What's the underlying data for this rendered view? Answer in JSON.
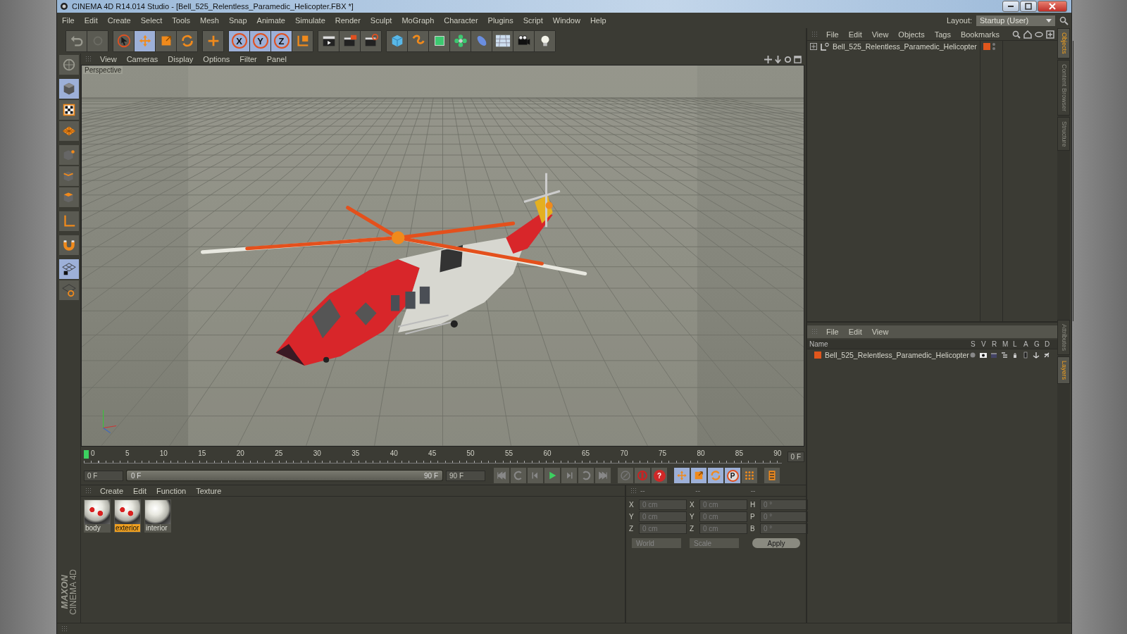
{
  "window": {
    "title": "CINEMA 4D R14.014 Studio - [Bell_525_Relentless_Paramedic_Helicopter.FBX *]"
  },
  "menu": [
    "File",
    "Edit",
    "Create",
    "Select",
    "Tools",
    "Mesh",
    "Snap",
    "Animate",
    "Simulate",
    "Render",
    "Sculpt",
    "MoGraph",
    "Character",
    "Plugins",
    "Script",
    "Window",
    "Help"
  ],
  "layout": {
    "label": "Layout:",
    "value": "Startup (User)"
  },
  "toolbar": [
    [
      {
        "kind": "undo",
        "selected": false
      },
      {
        "kind": "redo",
        "selected": false
      }
    ],
    [
      {
        "kind": "select",
        "selected": false
      },
      {
        "kind": "move",
        "selected": true
      },
      {
        "kind": "scale",
        "selected": false
      },
      {
        "kind": "rotate",
        "selected": false
      }
    ],
    [
      {
        "kind": "add",
        "selected": false
      }
    ],
    [
      {
        "kind": "axis",
        "label": "X",
        "selected": true
      },
      {
        "kind": "axis",
        "label": "Y",
        "selected": true
      },
      {
        "kind": "axis",
        "label": "Z",
        "selected": true
      },
      {
        "kind": "coord-system",
        "selected": false
      }
    ],
    [
      {
        "kind": "render-view",
        "selected": false
      },
      {
        "kind": "render-picture",
        "selected": false
      },
      {
        "kind": "render-settings",
        "selected": false
      }
    ],
    [
      {
        "kind": "cube",
        "selected": false
      },
      {
        "kind": "spline",
        "selected": false
      },
      {
        "kind": "nurbs",
        "selected": false
      },
      {
        "kind": "array",
        "selected": false
      },
      {
        "kind": "deformer",
        "selected": false
      },
      {
        "kind": "floor",
        "selected": false
      },
      {
        "kind": "camera",
        "selected": false
      },
      {
        "kind": "light",
        "selected": false
      }
    ]
  ],
  "side_tools": [
    [
      {
        "kind": "model",
        "selected": false
      }
    ],
    [
      {
        "kind": "object",
        "selected": true
      },
      {
        "kind": "texture",
        "selected": false
      },
      {
        "kind": "workplane",
        "selected": false
      }
    ],
    [
      {
        "kind": "points",
        "selected": false
      },
      {
        "kind": "edges",
        "selected": false
      },
      {
        "kind": "polygons",
        "selected": false
      }
    ],
    [
      {
        "kind": "axis-mode",
        "selected": false
      }
    ],
    [
      {
        "kind": "magnet",
        "selected": false
      }
    ],
    [
      {
        "kind": "snap",
        "selected": true
      },
      {
        "kind": "tweak",
        "selected": false
      }
    ]
  ],
  "viewport": {
    "menu": [
      "View",
      "Cameras",
      "Display",
      "Options",
      "Filter",
      "Panel"
    ],
    "camera": "Perspective"
  },
  "timeline": {
    "ticks": [
      "0",
      "5",
      "10",
      "15",
      "20",
      "25",
      "30",
      "35",
      "40",
      "45",
      "50",
      "55",
      "60",
      "65",
      "70",
      "75",
      "80",
      "85",
      "90"
    ],
    "current_frame": "0 F"
  },
  "transport": {
    "start": "0 F",
    "range_slider": {
      "start": "0 F",
      "end": "90 F",
      "level": 1
    },
    "end": "90 F",
    "buttons": [
      {
        "kind": "go-start",
        "selected": false
      },
      {
        "kind": "loop-back",
        "selected": false
      },
      {
        "kind": "prev-frame",
        "selected": false
      },
      {
        "kind": "play",
        "selected": false
      },
      {
        "kind": "next-frame",
        "selected": false
      },
      {
        "kind": "loop-forward",
        "selected": false
      },
      {
        "kind": "go-end",
        "selected": false
      },
      {
        "kind": "record-keys",
        "selected": false
      },
      {
        "kind": "auto-key",
        "selected": false
      },
      {
        "kind": "help",
        "label": "?",
        "selected": false
      },
      {
        "kind": "move",
        "selected": true
      },
      {
        "kind": "scale",
        "selected": true
      },
      {
        "kind": "rotate",
        "selected": true
      },
      {
        "kind": "param",
        "label": "P",
        "selected": true
      },
      {
        "kind": "grid",
        "selected": false
      },
      {
        "kind": "timeline",
        "selected": false
      }
    ]
  },
  "materials": {
    "menu": [
      "Create",
      "Edit",
      "Function",
      "Texture"
    ],
    "items": [
      {
        "name": "body",
        "selected": false
      },
      {
        "name": "exterior",
        "selected": true
      },
      {
        "name": "interior",
        "selected": false
      }
    ]
  },
  "coordinates": {
    "headers": [
      "--",
      "--",
      "--"
    ],
    "rows": [
      {
        "axis": "X",
        "position": "0 cm",
        "size_axis": "X",
        "size": "0 cm",
        "rot_axis": "H",
        "rotation": "0 °"
      },
      {
        "axis": "Y",
        "position": "0 cm",
        "size_axis": "Y",
        "size": "0 cm",
        "rot_axis": "P",
        "rotation": "0 °"
      },
      {
        "axis": "Z",
        "position": "0 cm",
        "size_axis": "Z",
        "size": "0 cm",
        "rot_axis": "B",
        "rotation": "0 °"
      }
    ],
    "mode": "World",
    "size_mode": "Scale",
    "apply": "Apply"
  },
  "objects": {
    "menu": [
      "File",
      "Edit",
      "View",
      "Objects",
      "Tags",
      "Bookmarks"
    ],
    "items": [
      {
        "name": "Bell_525_Relentless_Paramedic_Helicopter",
        "color": "#e0561c"
      }
    ]
  },
  "layers": {
    "menu": [
      "File",
      "Edit",
      "View"
    ],
    "columns": [
      "Name",
      "S",
      "V",
      "R",
      "M",
      "L",
      "A",
      "G",
      "D"
    ],
    "rows": [
      {
        "name": "Bell_525_Relentless_Paramedic_Helicopter",
        "color": "#e0561c"
      }
    ]
  },
  "side_tabs": [
    [
      {
        "label": "Objects",
        "selected": true
      },
      {
        "label": "Content Browser",
        "selected": false
      },
      {
        "label": "Structure",
        "selected": false
      }
    ],
    [
      {
        "label": "Attributes",
        "selected": false
      },
      {
        "label": "Layers",
        "selected": true
      }
    ]
  ],
  "logo": {
    "brand": "MAXON",
    "product": "CINEMA 4D"
  }
}
